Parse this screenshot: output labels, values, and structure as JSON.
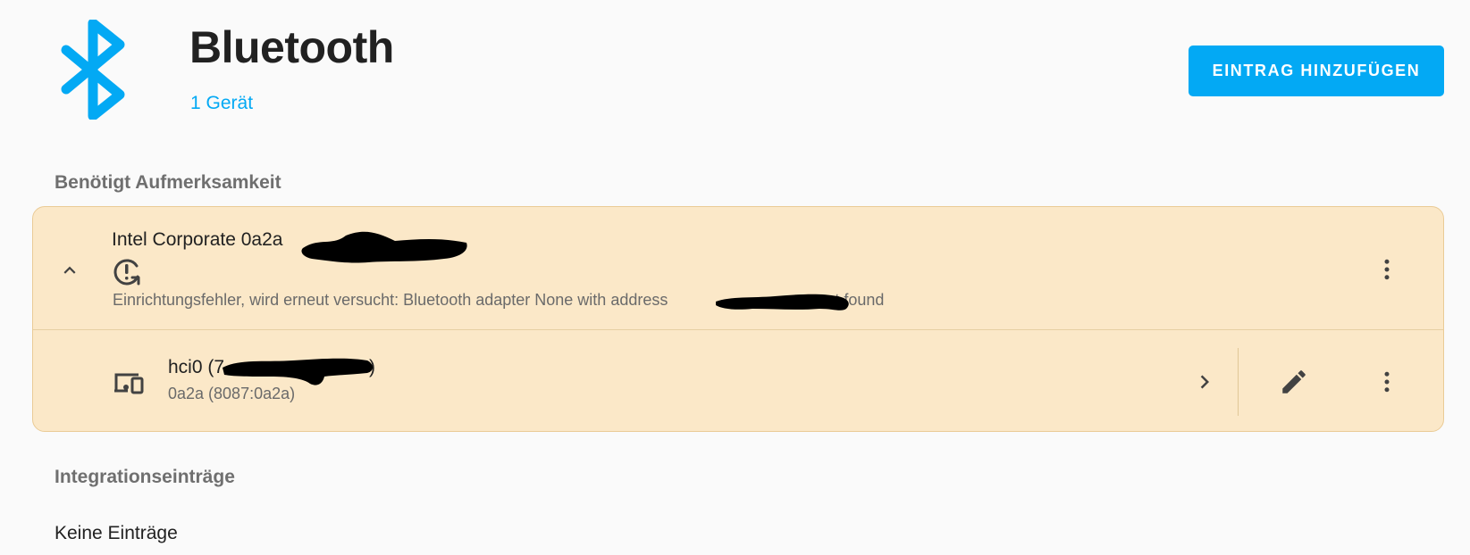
{
  "header": {
    "title": "Bluetooth",
    "device_count_link": "1 Gerät",
    "add_entry_button": "EINTRAG HINZUFÜGEN"
  },
  "attention_section": {
    "heading": "Benötigt Aufmerksamkeit",
    "entry": {
      "title": "Intel Corporate 0a2a",
      "error_prefix": "Einrichtungsfehler, wird erneut versucht: Bluetooth adapter None with address ",
      "error_suffix": "not found",
      "device": {
        "name_prefix": "hci0 (7",
        "name_suffix": ")",
        "subtitle": "0a2a (8087:0a2a)"
      }
    }
  },
  "integration_section": {
    "heading": "Integrationseinträge",
    "empty_text": "Keine Einträge"
  },
  "icons": {
    "logo": "bluetooth-icon",
    "expand": "chevron-up-icon",
    "status": "retry-error-icon",
    "device": "devices-icon",
    "navigate": "chevron-right-icon",
    "edit": "pencil-icon",
    "menu": "more-vertical-icon"
  },
  "colors": {
    "accent": "#03a9f4",
    "warning_card": "#fbe8c8",
    "background": "#fafafa"
  }
}
